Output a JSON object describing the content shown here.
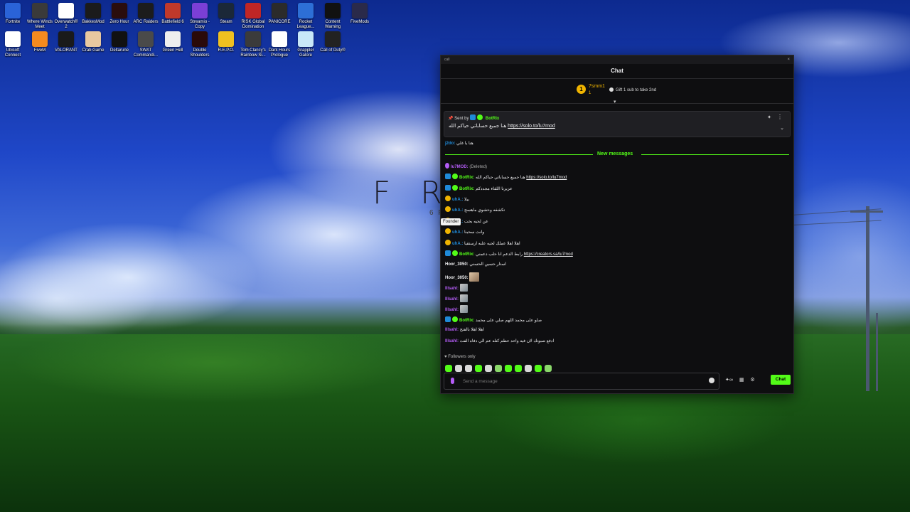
{
  "desktop": {
    "icons": [
      {
        "label": "Fortnite",
        "color": "#2a63d8"
      },
      {
        "label": "Where Winds Meet",
        "color": "#3a3a3a"
      },
      {
        "label": "Overwatch® 2",
        "color": "#ffffff"
      },
      {
        "label": "BakkesMod",
        "color": "#1b1b1b"
      },
      {
        "label": "Zero Hour",
        "color": "#2a0d0d"
      },
      {
        "label": "ARC Raiders",
        "color": "#1c1c1c"
      },
      {
        "label": "Battlefield 6",
        "color": "#c0392b"
      },
      {
        "label": "Streamio - Copy",
        "color": "#7b3fd6"
      },
      {
        "label": "Steam",
        "color": "#1b2838"
      },
      {
        "label": "RISK Global Domination",
        "color": "#c02626"
      },
      {
        "label": "PANICORE",
        "color": "#2b2b2b"
      },
      {
        "label": "Rocket League...",
        "color": "#2d6fd6"
      },
      {
        "label": "Content Warning",
        "color": "#111111"
      },
      {
        "label": "FiveMods",
        "color": "#2a2a4a"
      },
      {
        "label": "Ubisoft Connect",
        "color": "#ffffff"
      },
      {
        "label": "FiveM",
        "color": "#f48a1f"
      },
      {
        "label": "VALORANT",
        "color": "#1a1a1a"
      },
      {
        "label": "Crab Game",
        "color": "#e8c8a0"
      },
      {
        "label": "Deltarune",
        "color": "#111111"
      },
      {
        "label": "SWAT Commandi...",
        "color": "#4a4a4a"
      },
      {
        "label": "Green Hell",
        "color": "#eeeeee"
      },
      {
        "label": "Double Shoulders",
        "color": "#2a0a0a"
      },
      {
        "label": "R.E.P.O.",
        "color": "#f0c020"
      },
      {
        "label": "Tom Clancy's Rainbow Si...",
        "color": "#3b3b3b"
      },
      {
        "label": "Dark Hours Prologue",
        "color": "#ffffff"
      },
      {
        "label": "Grappler Galore",
        "color": "#c8e8f8"
      },
      {
        "label": "Call of Duty®",
        "color": "#222222"
      }
    ],
    "wallpaper_text": "F R",
    "wallpaper_sub": "6 F"
  },
  "window": {
    "title": "call",
    "close_label": "×"
  },
  "chat": {
    "header": "Chat",
    "leaderboard": {
      "rank": "1",
      "name": "7smm1",
      "count": "1",
      "gift_text": "Gift 1 sub to take 2nd"
    },
    "pinned": {
      "sent_by_prefix": "Sent by",
      "sent_by_user": "BotRix",
      "message_text": "هنا جميع حساباتي حياكم الله",
      "message_link": "https://solo.to/lu7mod"
    },
    "first_message": {
      "user": "j2do:",
      "text": "هنا يا غلي"
    },
    "new_messages_label": "New messages",
    "messages": [
      {
        "user": "lu7MOD:",
        "text": "(Deleted)",
        "badge": "mic",
        "color": "#b35cf5"
      },
      {
        "user": "BotRix:",
        "text": "هنا جميع حساباتي حياكم الله",
        "link": "https://solo.to/lu7mod",
        "badge": "bot",
        "color": "#53fc18"
      },
      {
        "user": "BotRix:",
        "text": "عزيزنا اللقاء مجددكم",
        "badge": "bot",
        "color": "#53fc18"
      },
      {
        "user": "uhA.:",
        "text": "بيلا",
        "badge": "coin",
        "color": "#1f8ad8"
      },
      {
        "user": "uhA.:",
        "text": "تكشفه وحشوي ماهسج",
        "badge": "coin",
        "color": "#1f8ad8"
      },
      {
        "user": "uhA.:",
        "text": "عن لحيه بخت",
        "badge": "coin",
        "color": "#1f8ad8"
      },
      {
        "user": "uhA.:",
        "text": "وانت سحبنا",
        "badge": "coin",
        "color": "#1f8ad8"
      },
      {
        "user": "uhA.:",
        "text": "اهلا اهلا عملك لحيه علىه ارستقيا",
        "badge": "coin",
        "color": "#1f8ad8"
      },
      {
        "user": "BotRix:",
        "text": "رابط الدعم انا حلب دعمني",
        "link": "https://creators.sa/lu7mod",
        "badge": "bot",
        "color": "#53fc18"
      },
      {
        "user": "Hoor_3050:",
        "text": "استار حسين الحسني",
        "badge": "",
        "color": "#efeff1"
      },
      {
        "user": "Hoor_3050:",
        "text": "",
        "emote": "img2",
        "badge": "",
        "color": "#efeff1"
      },
      {
        "user": "lllsahl:",
        "text": "",
        "emote": "img",
        "badge": "",
        "color": "#b35cf5"
      },
      {
        "user": "lllsahl:",
        "text": "",
        "emote": "img",
        "badge": "",
        "color": "#b35cf5"
      },
      {
        "user": "lllsahl:",
        "text": "",
        "emote": "img",
        "badge": "",
        "color": "#b35cf5"
      },
      {
        "user": "BotRix:",
        "text": "صلو على محمد اللهم صلي على محمد",
        "badge": "bot",
        "color": "#53fc18"
      },
      {
        "user": "lllsahl:",
        "text": "اهلا اهلا بالفتح",
        "badge": "",
        "color": "#b35cf5"
      },
      {
        "user": "lllsahl:",
        "text": "ادفع صبوتك لان فيه واحد حطم كتله عم الي دفاه الفت",
        "badge": "",
        "color": "#b35cf5"
      }
    ],
    "tooltip": "Founder",
    "followers_only": "Followers only",
    "input_placeholder": "Send a message",
    "chat_button": "Chat",
    "accent_color": "#53fc18"
  }
}
